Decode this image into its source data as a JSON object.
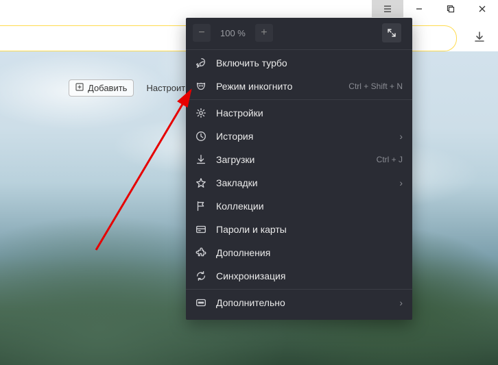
{
  "window": {
    "minimize": "–",
    "maximize": "❐",
    "close": "✕"
  },
  "toolbar": {
    "add_label": "Добавить",
    "configure_label": "Настроить э"
  },
  "zoom": {
    "minus": "−",
    "value": "100 %",
    "plus": "+"
  },
  "menu": {
    "turbo": "Включить турбо",
    "incognito": "Режим инкогнито",
    "incognito_hint": "Ctrl + Shift + N",
    "settings": "Настройки",
    "history": "История",
    "downloads": "Загрузки",
    "downloads_hint": "Ctrl + J",
    "bookmarks": "Закладки",
    "collections": "Коллекции",
    "passwords": "Пароли и карты",
    "addons": "Дополнения",
    "sync": "Синхронизация",
    "more": "Дополнительно"
  }
}
